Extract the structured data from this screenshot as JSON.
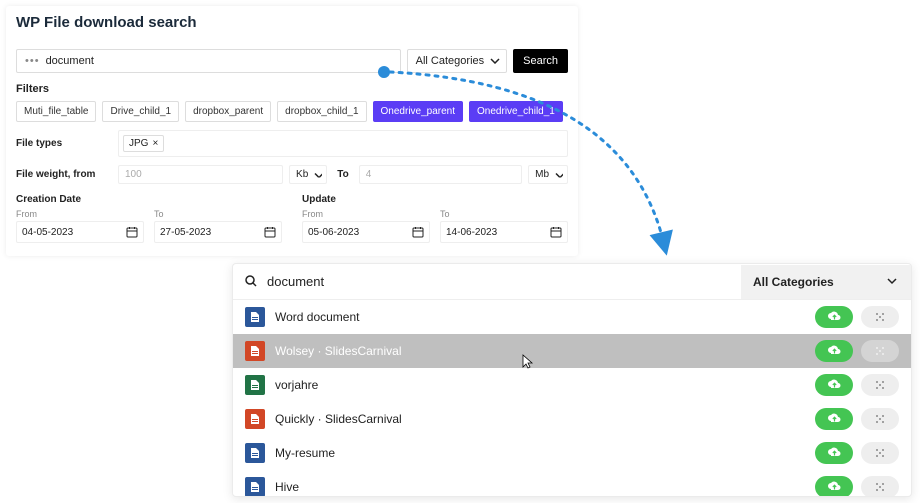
{
  "panel1": {
    "heading": "WP File download search",
    "search_text": "document",
    "category": "All Categories",
    "search_button": "Search",
    "filters_label": "Filters",
    "filter_chips": [
      {
        "label": "Muti_file_table",
        "active": false
      },
      {
        "label": "Drive_child_1",
        "active": false
      },
      {
        "label": "dropbox_parent",
        "active": false
      },
      {
        "label": "dropbox_child_1",
        "active": false
      },
      {
        "label": "Onedrive_parent",
        "active": true
      },
      {
        "label": "Onedrive_child_1",
        "active": true
      }
    ],
    "filetypes_label": "File types",
    "filetype_tag": "JPG",
    "tag_x": "×",
    "weight_label": "File weight, from",
    "weight_from_value": "100",
    "weight_from_unit": "Kb",
    "weight_to_label": "To",
    "weight_to_value": "4",
    "weight_to_unit": "Mb",
    "creation_label": "Creation Date",
    "update_label": "Update",
    "from_label": "From",
    "to_label": "To",
    "creation_from": "04-05-2023",
    "creation_to": "27-05-2023",
    "update_from": "05-06-2023",
    "update_to": "14-06-2023"
  },
  "panel2": {
    "search_text": "document",
    "category": "All Categories",
    "rows": [
      {
        "name": "Word document",
        "color": "#2b579a",
        "hover": false
      },
      {
        "name": "Wolsey · SlidesCarnival",
        "color": "#d24726",
        "hover": true
      },
      {
        "name": "vorjahre",
        "color": "#217346",
        "hover": false
      },
      {
        "name": "Quickly · SlidesCarnival",
        "color": "#d24726",
        "hover": false
      },
      {
        "name": "My-resume",
        "color": "#2b579a",
        "hover": false
      },
      {
        "name": "Hive",
        "color": "#2b579a",
        "hover": false
      }
    ]
  },
  "colors": {
    "accent_arrow": "#2b8cd9",
    "chip_active": "#5b3df5",
    "pill_green": "#44c553"
  }
}
